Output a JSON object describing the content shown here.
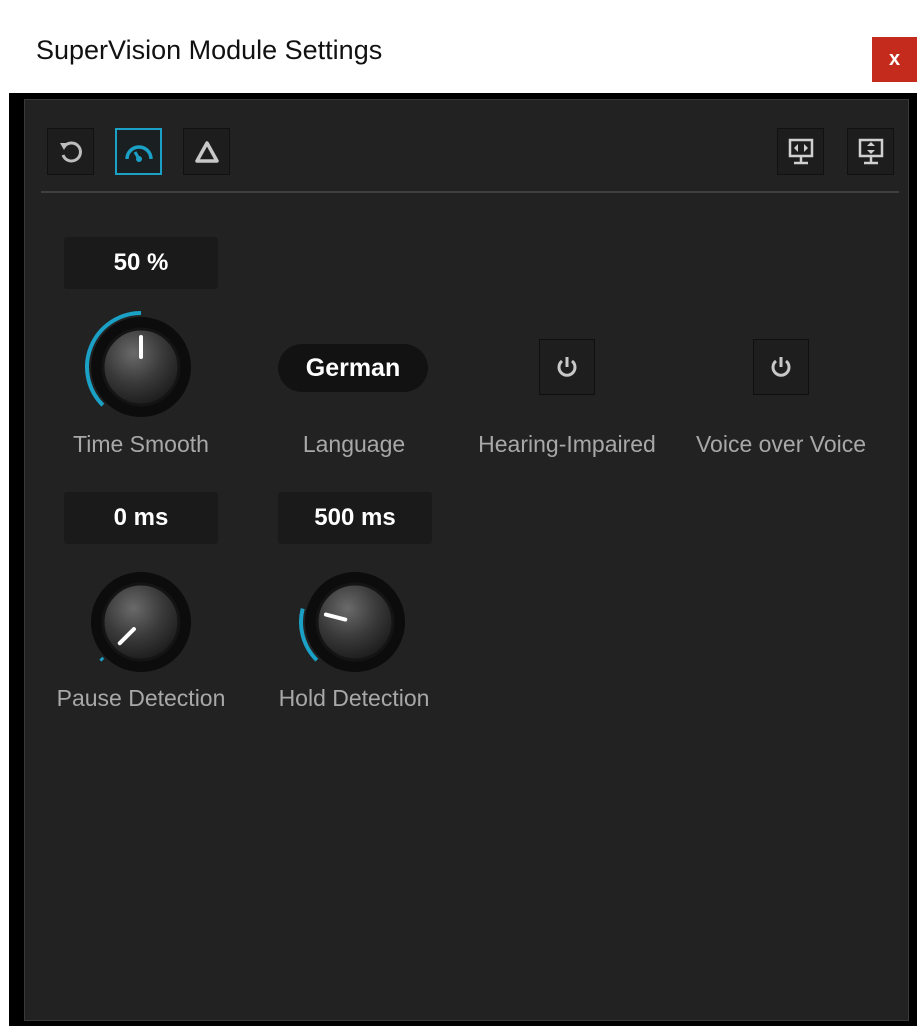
{
  "window": {
    "title": "SuperVision Module Settings",
    "close_label": "x"
  },
  "colors": {
    "accent": "#1ba0c6",
    "panel": "#222222",
    "label": "#a8a8a8"
  },
  "toolbar": {
    "left_buttons": [
      {
        "icon": "reset-icon",
        "active": false
      },
      {
        "icon": "gauge-icon",
        "active": true
      },
      {
        "icon": "triangle-icon",
        "active": false
      }
    ],
    "right_buttons": [
      {
        "icon": "monitor-horizontal-icon"
      },
      {
        "icon": "monitor-vertical-icon"
      }
    ]
  },
  "controls": {
    "time_smooth": {
      "readout": "50 %",
      "label": "Time Smooth",
      "level": 0.5
    },
    "language": {
      "value": "German",
      "label": "Language"
    },
    "hearing_impaired": {
      "label": "Hearing-Impaired",
      "icon": "power-icon"
    },
    "voice_over_voice": {
      "label": "Voice over Voice",
      "icon": "power-icon"
    },
    "pause_detection": {
      "readout": "0 ms",
      "label": "Pause Detection",
      "level": 0.0
    },
    "hold_detection": {
      "readout": "500 ms",
      "label": "Hold Detection",
      "level": 0.22
    }
  }
}
